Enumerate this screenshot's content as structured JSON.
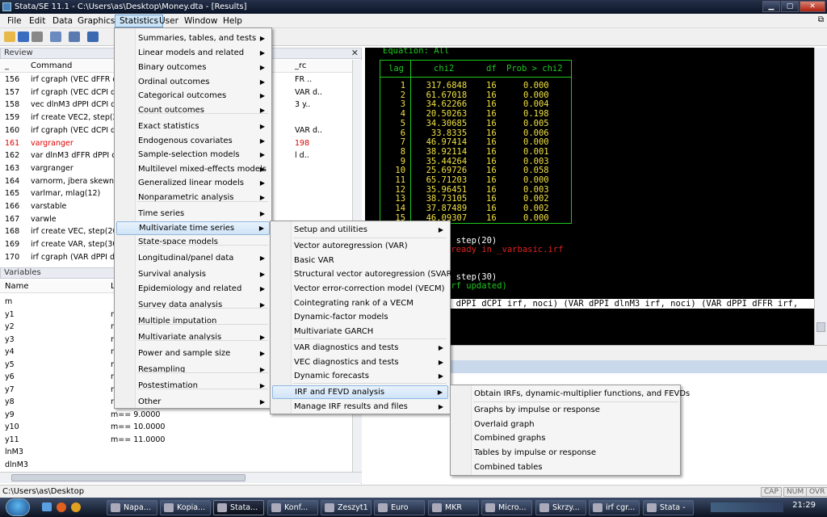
{
  "window": {
    "title": "Stata/SE 11.1 - C:\\Users\\as\\Desktop\\Money.dta - [Results]"
  },
  "menubar": [
    "File",
    "Edit",
    "Data",
    "Graphics",
    "Statistics",
    "User",
    "Window",
    "Help"
  ],
  "review": {
    "title": "Review",
    "col_num": "_",
    "col_command": "Command",
    "col_rc": "_rc",
    "rows": [
      {
        "n": "156",
        "cmd": "irf cgraph (VEC dFFR dIn"
      },
      {
        "n": "157",
        "cmd": "irf cgraph (VEC dCPI dIn"
      },
      {
        "n": "158",
        "cmd": "vec dlnM3 dPPI dCPI dF"
      },
      {
        "n": "159",
        "cmd": "irf create VEC2, step(20)"
      },
      {
        "n": "160",
        "cmd": "irf cgraph (VEC dCPI dIn"
      },
      {
        "n": "161",
        "cmd": "vargranger"
      },
      {
        "n": "162",
        "cmd": "var dlnM3 dFFR dPPI dC"
      },
      {
        "n": "163",
        "cmd": "vargranger"
      },
      {
        "n": "164",
        "cmd": "varnorm, jbera skewness"
      },
      {
        "n": "165",
        "cmd": "varlmar, mlag(12)"
      },
      {
        "n": "166",
        "cmd": "varstable"
      },
      {
        "n": "167",
        "cmd": "varwle"
      },
      {
        "n": "168",
        "cmd": "irf create VEC, step(20)"
      },
      {
        "n": "169",
        "cmd": "irf create VAR, step(30)"
      },
      {
        "n": "170",
        "cmd": "irf cgraph (VAR dPPI dCPI"
      }
    ],
    "overflow_fragments": [
      "FR ..",
      "VAR d..",
      "3 y..",
      "VAR d..",
      "l d.."
    ],
    "rc_value": "198"
  },
  "variables": {
    "title": "Variables",
    "col_name": "Name",
    "col_label": "L",
    "rows": [
      {
        "name": "m",
        "label": ""
      },
      {
        "name": "y1",
        "label": "m"
      },
      {
        "name": "y2",
        "label": "m"
      },
      {
        "name": "y3",
        "label": "m"
      },
      {
        "name": "y4",
        "label": "m"
      },
      {
        "name": "y5",
        "label": "m"
      },
      {
        "name": "y6",
        "label": "m"
      },
      {
        "name": "y7",
        "label": "m"
      },
      {
        "name": "y8",
        "label": "m"
      },
      {
        "name": "y9",
        "label": "m==     9.0000"
      },
      {
        "name": "y10",
        "label": "m==     10.0000"
      },
      {
        "name": "y11",
        "label": "m==     11.0000"
      },
      {
        "name": "lnM3",
        "label": ""
      },
      {
        "name": "dlnM3",
        "label": ""
      }
    ]
  },
  "results": {
    "equation_line": "Equation: All",
    "table_headers": [
      "lag",
      "chi2",
      "df",
      "Prob > chi2"
    ],
    "table_rows": [
      [
        "1",
        "317.6848",
        "16",
        "0.000"
      ],
      [
        "2",
        "61.67018",
        "16",
        "0.000"
      ],
      [
        "3",
        "34.62266",
        "16",
        "0.004"
      ],
      [
        "4",
        "20.50263",
        "16",
        "0.198"
      ],
      [
        "5",
        "34.30685",
        "16",
        "0.005"
      ],
      [
        "6",
        "33.8335",
        "16",
        "0.006"
      ],
      [
        "7",
        "46.97414",
        "16",
        "0.000"
      ],
      [
        "8",
        "38.92114",
        "16",
        "0.001"
      ],
      [
        "9",
        "35.44264",
        "16",
        "0.003"
      ],
      [
        "10",
        "25.69726",
        "16",
        "0.058"
      ],
      [
        "11",
        "65.71203",
        "16",
        "0.000"
      ],
      [
        "12",
        "35.96451",
        "16",
        "0.003"
      ],
      [
        "13",
        "38.73105",
        "16",
        "0.002"
      ],
      [
        "14",
        "37.87489",
        "16",
        "0.002"
      ],
      [
        "15",
        "46.09307",
        "16",
        "0.000"
      ]
    ],
    "line1": ", step(20)",
    "line2": "lready in _varbasic.irf",
    "line3": ", step(30)",
    "line4": "irf updated)",
    "line5": "R dPPI dCPI irf, noci) (VAR dPPI dlnM3 irf, noci) (VAR dPPI dFFR irf,"
  },
  "menu_statistics": [
    {
      "label": "Summaries, tables, and tests",
      "sub": true
    },
    {
      "label": "Linear models and related",
      "sub": true
    },
    {
      "label": "Binary outcomes",
      "sub": true
    },
    {
      "label": "Ordinal outcomes",
      "sub": true
    },
    {
      "label": "Categorical outcomes",
      "sub": true
    },
    {
      "label": "Count outcomes",
      "sub": true
    },
    {
      "label": "Exact statistics",
      "sub": true
    },
    {
      "label": "Endogenous covariates",
      "sub": true
    },
    {
      "label": "Sample-selection models",
      "sub": true
    },
    {
      "label": "Multilevel mixed-effects models",
      "sub": true
    },
    {
      "label": "Generalized linear models",
      "sub": true
    },
    {
      "label": "Nonparametric analysis",
      "sub": true
    },
    {
      "label": "Time series",
      "sub": true
    },
    {
      "label": "Multivariate time series",
      "sub": true
    },
    {
      "label": "State-space models",
      "sub": false
    },
    {
      "label": "Longitudinal/panel data",
      "sub": true
    },
    {
      "label": "Survival analysis",
      "sub": true
    },
    {
      "label": "Epidemiology and related",
      "sub": true
    },
    {
      "label": "Survey data analysis",
      "sub": true
    },
    {
      "label": "Multiple imputation",
      "sub": false
    },
    {
      "label": "Multivariate analysis",
      "sub": true
    },
    {
      "label": "Power and sample size",
      "sub": true
    },
    {
      "label": "Resampling",
      "sub": true
    },
    {
      "label": "Postestimation",
      "sub": true
    },
    {
      "label": "Other",
      "sub": true
    }
  ],
  "menu_mts": [
    {
      "label": "Setup and utilities",
      "sub": true
    },
    {
      "label": "Vector autoregression (VAR)",
      "sub": false
    },
    {
      "label": "Basic VAR",
      "sub": false
    },
    {
      "label": "Structural vector autoregression (SVAR)",
      "sub": false
    },
    {
      "label": "Vector error-correction model (VECM)",
      "sub": false
    },
    {
      "label": "Cointegrating rank of a VECM",
      "sub": false
    },
    {
      "label": "Dynamic-factor models",
      "sub": false
    },
    {
      "label": "Multivariate GARCH",
      "sub": false
    },
    {
      "label": "VAR diagnostics and tests",
      "sub": true
    },
    {
      "label": "VEC diagnostics and tests",
      "sub": true
    },
    {
      "label": "Dynamic forecasts",
      "sub": true
    },
    {
      "label": "IRF and FEVD analysis",
      "sub": true
    },
    {
      "label": "Manage IRF results and files",
      "sub": true
    }
  ],
  "menu_irf": [
    {
      "label": "Obtain IRFs, dynamic-multiplier functions, and FEVDs"
    },
    {
      "label": "Graphs by impulse or response"
    },
    {
      "label": "Overlaid graph"
    },
    {
      "label": "Combined graphs"
    },
    {
      "label": "Tables by impulse or response"
    },
    {
      "label": "Combined tables"
    }
  ],
  "statusbar": {
    "path": "C:\\Users\\as\\Desktop",
    "cap": "CAP",
    "num": "NUM",
    "ovr": "OVR"
  },
  "taskbar": {
    "items": [
      "Napa...",
      "Kopia...",
      "Stata...",
      "Konf...",
      "Zeszyt1",
      "Euro",
      "MKR",
      "Micro...",
      "Skrzy...",
      "irf cgr...",
      "Stata -"
    ],
    "clock": "21:29"
  },
  "colors": {
    "result_green": "#1ec81e",
    "result_yellow": "#f0e040",
    "result_red": "#e02020",
    "menu_highlight": "#cfe4f7"
  }
}
